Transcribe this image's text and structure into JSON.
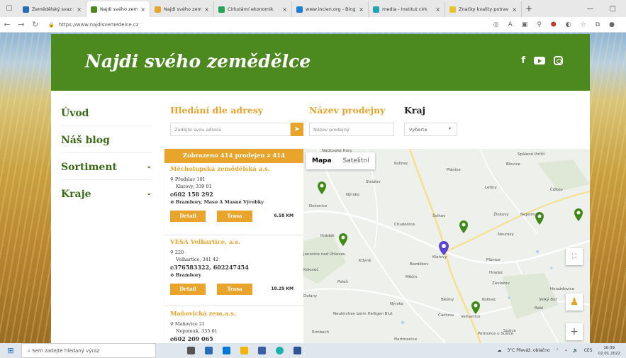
{
  "browser": {
    "tabs": [
      {
        "title": "Zemědělský svaz spu",
        "color": "#2a6bb5"
      },
      {
        "title": "Najdi svého zeměd",
        "color": "#4c8a1f",
        "active": true
      },
      {
        "title": "Najdi svého zeměd",
        "color": "#e8a42b"
      },
      {
        "title": "Cirkulární ekonomik",
        "color": "#27a35a"
      },
      {
        "title": "www.incien.org - Bing",
        "color": "#1c7ed6"
      },
      {
        "title": "media - Institut cirk",
        "color": "#20a4b5"
      },
      {
        "title": "Značky kvality potrav",
        "color": "#e8c42b"
      }
    ],
    "url": "https://www.najdisvemedelce.cz"
  },
  "header": {
    "logo": "Najdi svého zemědělce",
    "social": [
      "facebook-icon",
      "youtube-icon",
      "instagram-icon"
    ],
    "facebook_glyph": "f"
  },
  "sidebar": {
    "items": [
      {
        "label": "Úvod",
        "chevron": false
      },
      {
        "label": "Náš blog",
        "chevron": false
      },
      {
        "label": "Sortiment",
        "chevron": true
      },
      {
        "label": "Kraje",
        "chevron": true
      }
    ]
  },
  "search": {
    "address_title": "Hledání dle adresy",
    "address_placeholder": "Zadejte svou adresu",
    "shop_title": "Název prodejny",
    "shop_placeholder": "Název prodejny",
    "region_title": "Kraj",
    "region_value": "Vyberte"
  },
  "results": {
    "header": "Zobrazeno 414 prodejen z 414",
    "detail_label": "Detail",
    "route_label": "Trasa",
    "items": [
      {
        "name": "Měcholupská zemědělská a.s.",
        "street": "Předslav 101",
        "city": "Klatovy, 339 01",
        "phone": "602 158 292",
        "products": "Brambory, Maso A Masné Výrobky",
        "distance": "6.58 KM"
      },
      {
        "name": "VESA Velhartice, a.s.",
        "street": "220",
        "city": "Velhartice, 341 42",
        "phone": "376583322, 602247454",
        "products": "Brambory",
        "distance": "18.29 KM"
      },
      {
        "name": "Maňovická zem.a.s.",
        "street": "Maňovice 21",
        "city": "Nepomuk, 335 01",
        "phone": "602 209 065",
        "products": "",
        "distance": ""
      }
    ]
  },
  "map": {
    "type_map": "Mapa",
    "type_satellite": "Satelitní",
    "towns": [
      "Švihov",
      "Chudenice",
      "Klatovy",
      "Nepomuk",
      "Plánice",
      "Nalžovské Hory",
      "Horažďovice",
      "Sušice",
      "Nýrsko",
      "Kolinec",
      "Bezděkov",
      "Janovice nad Úhlavou",
      "Strážov",
      "Dešenice",
      "Běšiny",
      "Velhartice",
      "Petrovice u Sušice",
      "Hrádek",
      "Mochtín",
      "Kdyně",
      "Koloveč",
      "Poleň",
      "Neukirchen beim Heiligen Blut",
      "Rimbach",
      "Lohberg",
      "Dolany",
      "Plešice",
      "Měčín",
      "Blovice",
      "Spálené Poříčí",
      "Letiny",
      "Čížkov",
      "Žinkovy",
      "Neurazy",
      "Nekvasovy",
      "Velký Bor",
      "Rabí",
      "Hartmanice",
      "Prášily",
      "Chanovice",
      "Stěnovice"
    ],
    "fullscreen_icon": "fullscreen-icon",
    "pegman_icon": "pegman-icon",
    "zoom_in": "+"
  },
  "taskbar": {
    "search_placeholder": "Sem zadejte hledaný výraz",
    "weather": "3°C Převáž. oblačno",
    "lang": "CES",
    "time": "10:39",
    "date": "02.01.2022"
  },
  "colors": {
    "green": "#4c8a1f",
    "orange": "#e8a42b",
    "pin_green": "#3f8a14",
    "pin_blue": "#5b45d6"
  }
}
